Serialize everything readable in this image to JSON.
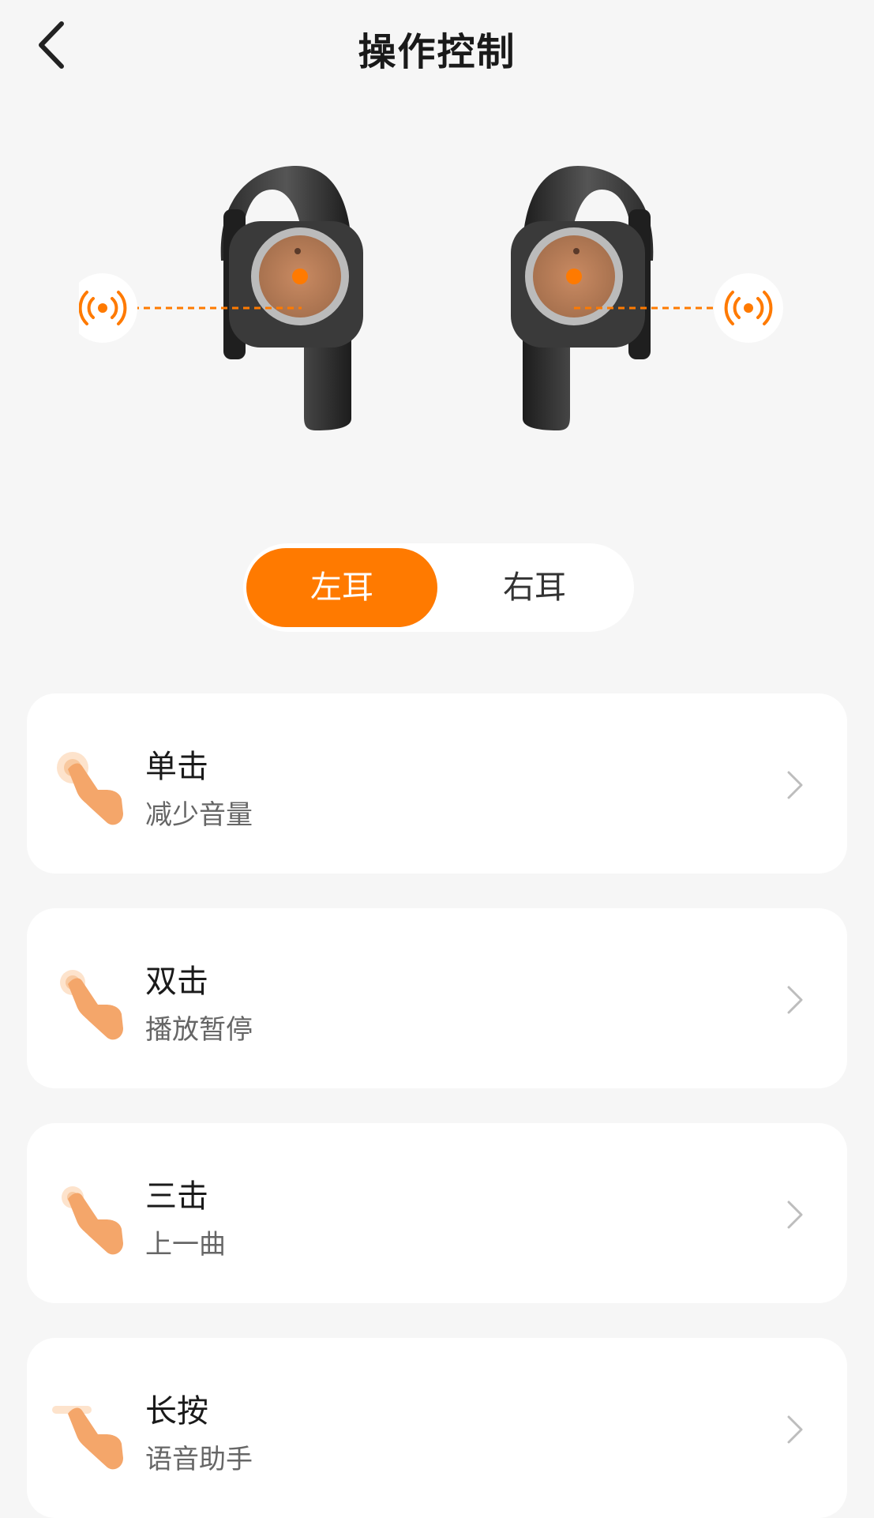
{
  "header": {
    "title": "操作控制",
    "back_icon": "chevron-left-icon"
  },
  "image": {
    "alt_icons": [
      "signal-icon-left",
      "signal-icon-right"
    ],
    "accent": "#ff7a00"
  },
  "tabs": [
    {
      "label": "左耳",
      "selected": true
    },
    {
      "label": "右耳",
      "selected": false
    }
  ],
  "controls": [
    {
      "title": "单击",
      "action": "减少音量",
      "icon": "tap-hand-icon"
    },
    {
      "title": "双击",
      "action": "播放暂停",
      "icon": "double-tap-hand-icon"
    },
    {
      "title": "三击",
      "action": "上一曲",
      "icon": "triple-tap-hand-icon"
    },
    {
      "title": "长按",
      "action": "语音助手",
      "icon": "long-press-hand-icon"
    }
  ],
  "colors": {
    "accent": "#ff7a00",
    "background": "#f6f6f6",
    "card": "#ffffff"
  }
}
